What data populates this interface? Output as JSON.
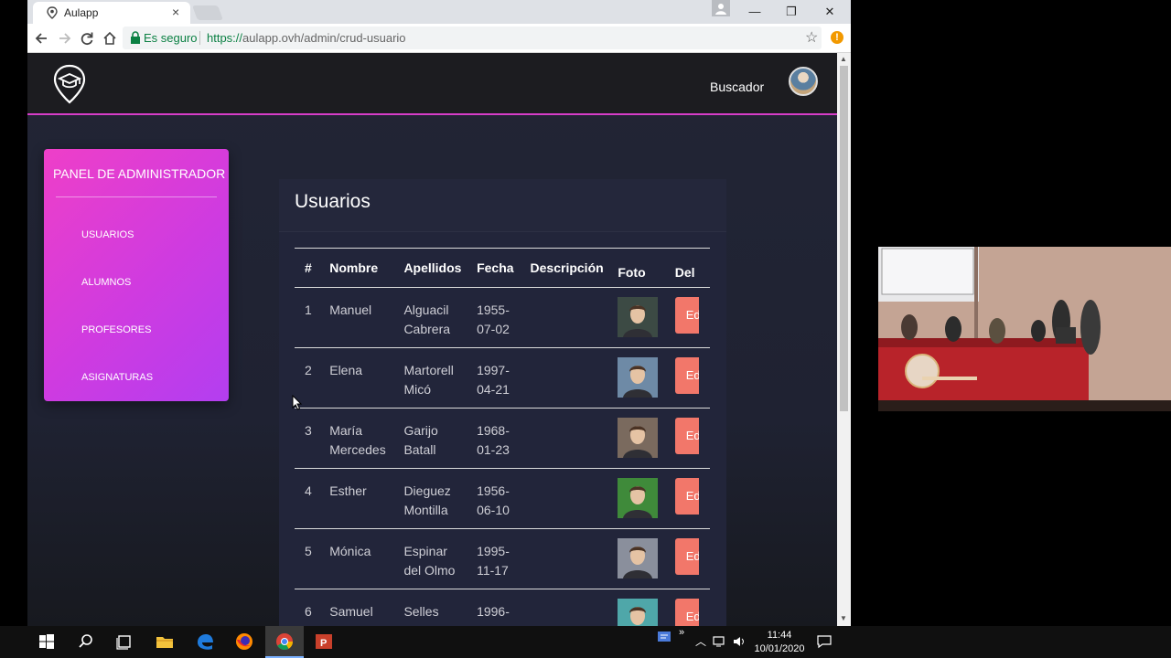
{
  "browser": {
    "tab_title": "Aulapp",
    "tab_close": "×",
    "secure_label": "Es seguro",
    "url_protocol": "https://",
    "url_rest": "aulapp.ovh/admin/crud-usuario",
    "window_minimize": "—",
    "window_maximize": "❐",
    "window_close": "✕"
  },
  "header": {
    "search_link": "Buscador"
  },
  "admin_panel": {
    "title": "PANEL DE ADMINISTRADOR",
    "items": [
      "USUARIOS",
      "ALUMNOS",
      "PROFESORES",
      "ASIGNATURAS"
    ]
  },
  "users": {
    "title": "Usuarios",
    "columns": [
      "#",
      "Nombre",
      "Apellidos",
      "Fecha",
      "Descripción",
      "Foto",
      "Del"
    ],
    "edit_label": "Ed",
    "rows": [
      {
        "id": "1",
        "nombre": [
          "Manuel",
          ""
        ],
        "apellidos": [
          "Alguacil",
          "Cabrera"
        ],
        "fecha": [
          "1955-",
          "07-02"
        ],
        "descripcion": ""
      },
      {
        "id": "2",
        "nombre": [
          "Elena",
          ""
        ],
        "apellidos": [
          "Martorell",
          "Micó"
        ],
        "fecha": [
          "1997-",
          "04-21"
        ],
        "descripcion": ""
      },
      {
        "id": "3",
        "nombre": [
          "María",
          "Mercedes"
        ],
        "apellidos": [
          "Garijo",
          "Batall"
        ],
        "fecha": [
          "1968-",
          "01-23"
        ],
        "descripcion": ""
      },
      {
        "id": "4",
        "nombre": [
          "Esther",
          ""
        ],
        "apellidos": [
          "Dieguez",
          "Montilla"
        ],
        "fecha": [
          "1956-",
          "06-10"
        ],
        "descripcion": ""
      },
      {
        "id": "5",
        "nombre": [
          "Mónica",
          ""
        ],
        "apellidos": [
          "Espinar",
          "del Olmo"
        ],
        "fecha": [
          "1995-",
          "11-17"
        ],
        "descripcion": ""
      },
      {
        "id": "6",
        "nombre": [
          "Samuel",
          ""
        ],
        "apellidos": [
          "Selles",
          ""
        ],
        "fecha": [
          "1996-",
          ""
        ],
        "descripcion": ""
      }
    ]
  },
  "photo_colors": [
    "#3c4a44",
    "#6e8aa6",
    "#7a6a5e",
    "#3f8a3a",
    "#8a8f9c",
    "#4fa7a9"
  ],
  "accent_colors": {
    "header_line": "#d63dc8",
    "panel": "#cf3be0",
    "edit_button": "#f2776a"
  },
  "taskbar": {
    "time": "11:44",
    "date": "10/01/2020",
    "apps": [
      "start-icon",
      "search-icon",
      "task-view-icon",
      "file-explorer-icon",
      "edge-icon",
      "firefox-icon",
      "chrome-icon",
      "powerpoint-icon"
    ]
  }
}
